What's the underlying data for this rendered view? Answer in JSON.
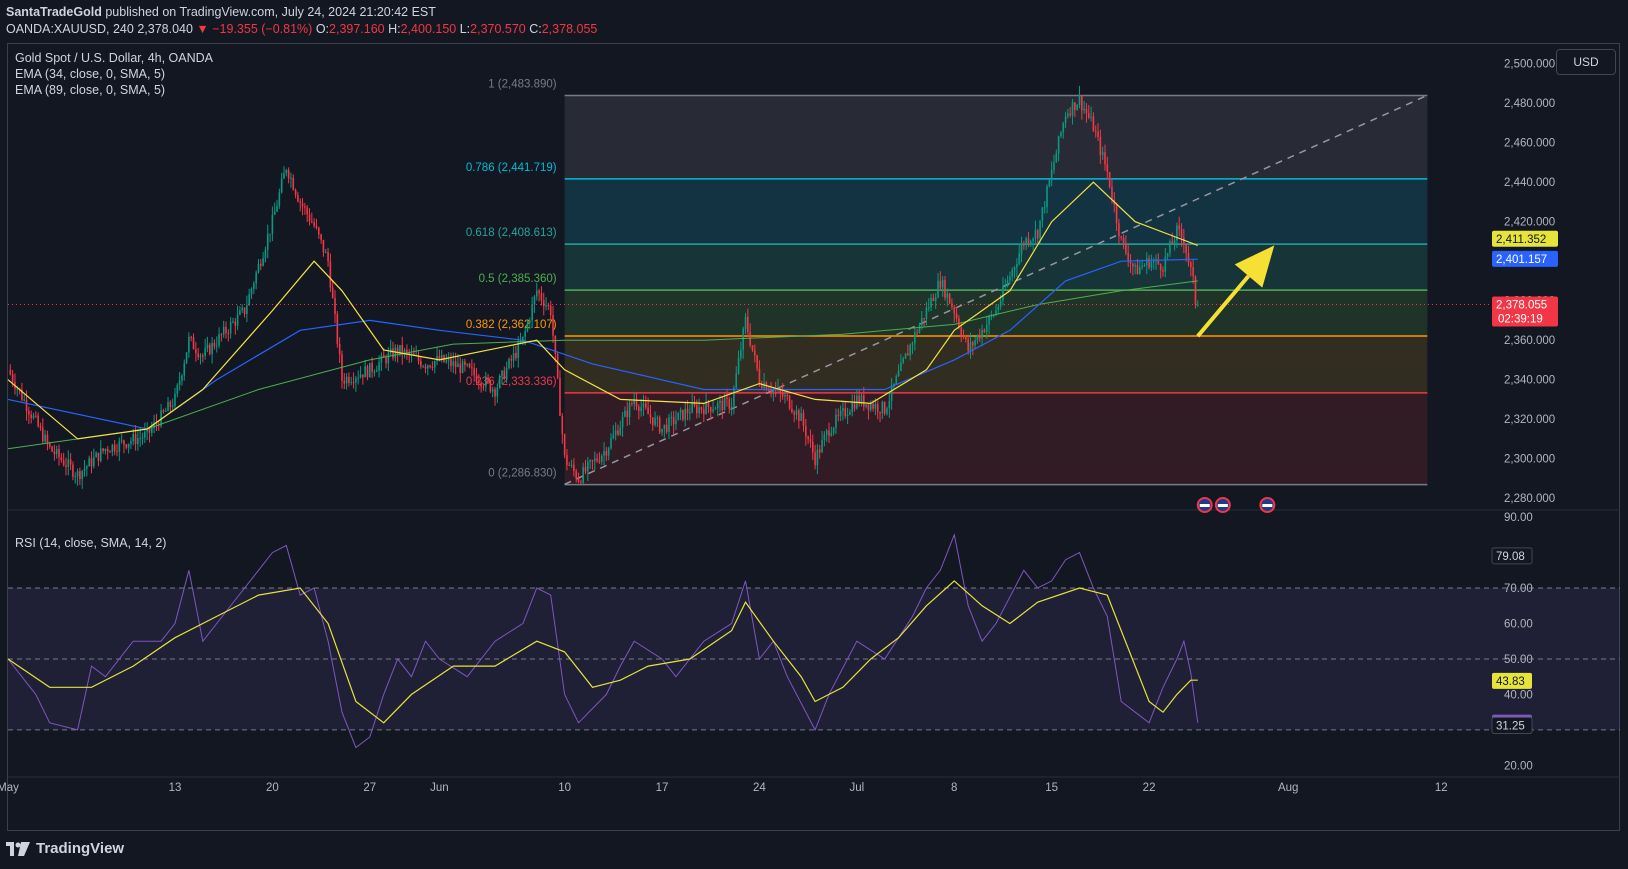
{
  "header": {
    "publisher": "SantaTradeGold",
    "published_text": "published on TradingView.com, July 24, 2024 21:20:42 EST",
    "symbol": "OANDA:XAUUSD, 240",
    "last": "2,378.040",
    "change": "▼ −19.355 (−0.81%)",
    "o_label": "O:",
    "o_value": "2,397.160",
    "h_label": "H:",
    "h_value": "2,400.150",
    "l_label": "L:",
    "l_value": "2,370.570",
    "c_label": "C:",
    "c_value": "2,378.055"
  },
  "legend": {
    "title": "Gold Spot / U.S. Dollar, 4h, OANDA",
    "ema34": "EMA (34, close, 0, SMA, 5)",
    "ema89": "EMA (89, close, 0, SMA, 5)",
    "rsi": "RSI (14, close, SMA, 14, 2)"
  },
  "currency_button": "USD",
  "footer": {
    "brand": "TradingView"
  },
  "colors": {
    "background": "#131722",
    "bull": "#089981",
    "bear": "#f23645",
    "ema34": "#f5e33d",
    "ema89": "#2962ff",
    "ema_long": "#4caf50",
    "rsi": "#7e57c2",
    "rsi_ma": "#e6e33a",
    "arrow": "#f5e033"
  },
  "chart_data": [
    {
      "type": "candlestick",
      "title": "Gold Spot / U.S. Dollar, 4h, OANDA",
      "ylim": [
        2275,
        2510
      ],
      "y_ticks": [
        "2,280.000",
        "2,300.000",
        "2,320.000",
        "2,340.000",
        "2,360.000",
        "2,380.000",
        "2,400.000",
        "2,420.000",
        "2,440.000",
        "2,460.000",
        "2,480.000",
        "2,500.000"
      ],
      "x_ticks": [
        "May",
        "13",
        "20",
        "27",
        "Jun",
        "10",
        "17",
        "24",
        "Jul",
        "8",
        "15",
        "22",
        "Aug",
        "12"
      ],
      "x_tick_days": [
        0,
        12,
        19,
        26,
        31,
        40,
        47,
        54,
        61,
        68,
        75,
        82,
        92,
        103
      ],
      "price_path": [
        [
          0,
          2345
        ],
        [
          3,
          2305
        ],
        [
          5,
          2292
        ],
        [
          7,
          2305
        ],
        [
          10,
          2312
        ],
        [
          12,
          2330
        ],
        [
          13,
          2360
        ],
        [
          14,
          2352
        ],
        [
          17,
          2375
        ],
        [
          19,
          2420
        ],
        [
          20,
          2448
        ],
        [
          21,
          2430
        ],
        [
          22,
          2418
        ],
        [
          23,
          2400
        ],
        [
          24,
          2340
        ],
        [
          26,
          2345
        ],
        [
          28,
          2355
        ],
        [
          30,
          2348
        ],
        [
          31,
          2350
        ],
        [
          33,
          2345
        ],
        [
          35,
          2335
        ],
        [
          37,
          2360
        ],
        [
          38,
          2385
        ],
        [
          39,
          2375
        ],
        [
          40,
          2300
        ],
        [
          41,
          2290
        ],
        [
          43,
          2305
        ],
        [
          45,
          2330
        ],
        [
          47,
          2315
        ],
        [
          49,
          2325
        ],
        [
          52,
          2328
        ],
        [
          53,
          2370
        ],
        [
          54,
          2340
        ],
        [
          56,
          2330
        ],
        [
          57,
          2320
        ],
        [
          58,
          2300
        ],
        [
          59,
          2315
        ],
        [
          61,
          2330
        ],
        [
          63,
          2325
        ],
        [
          65,
          2360
        ],
        [
          67,
          2390
        ],
        [
          68,
          2375
        ],
        [
          69,
          2355
        ],
        [
          71,
          2375
        ],
        [
          73,
          2410
        ],
        [
          74,
          2415
        ],
        [
          75,
          2445
        ],
        [
          76,
          2475
        ],
        [
          77,
          2482
        ],
        [
          78,
          2468
        ],
        [
          79,
          2445
        ],
        [
          80,
          2410
        ],
        [
          81,
          2395
        ],
        [
          82,
          2400
        ],
        [
          83,
          2398
        ],
        [
          84,
          2415
        ],
        [
          84.5,
          2411
        ],
        [
          85,
          2395
        ],
        [
          85.5,
          2378
        ]
      ],
      "ema34_path": [
        [
          0,
          2340
        ],
        [
          5,
          2310
        ],
        [
          10,
          2315
        ],
        [
          14,
          2335
        ],
        [
          19,
          2375
        ],
        [
          22,
          2400
        ],
        [
          24,
          2385
        ],
        [
          27,
          2355
        ],
        [
          31,
          2350
        ],
        [
          38,
          2360
        ],
        [
          40,
          2345
        ],
        [
          44,
          2330
        ],
        [
          50,
          2328
        ],
        [
          54,
          2338
        ],
        [
          58,
          2330
        ],
        [
          62,
          2328
        ],
        [
          66,
          2345
        ],
        [
          68,
          2365
        ],
        [
          72,
          2385
        ],
        [
          75,
          2420
        ],
        [
          78,
          2440
        ],
        [
          81,
          2420
        ],
        [
          84,
          2412
        ],
        [
          85.5,
          2408
        ]
      ],
      "ema89_path": [
        [
          0,
          2330
        ],
        [
          10,
          2315
        ],
        [
          15,
          2340
        ],
        [
          21,
          2365
        ],
        [
          26,
          2370
        ],
        [
          31,
          2365
        ],
        [
          37,
          2360
        ],
        [
          42,
          2348
        ],
        [
          50,
          2335
        ],
        [
          57,
          2335
        ],
        [
          63,
          2335
        ],
        [
          68,
          2350
        ],
        [
          72,
          2365
        ],
        [
          76,
          2390
        ],
        [
          80,
          2400
        ],
        [
          85.5,
          2401
        ]
      ],
      "ema_long_path": [
        [
          0,
          2305
        ],
        [
          10,
          2315
        ],
        [
          18,
          2335
        ],
        [
          26,
          2350
        ],
        [
          32,
          2358
        ],
        [
          40,
          2360
        ],
        [
          50,
          2360
        ],
        [
          60,
          2363
        ],
        [
          68,
          2368
        ],
        [
          74,
          2378
        ],
        [
          80,
          2385
        ],
        [
          85.5,
          2390
        ]
      ],
      "fibonacci": {
        "start_day": 40,
        "end_day": 102,
        "levels": [
          {
            "label": "1 (2,483.890)",
            "value": 2483.89,
            "color": "#787b86"
          },
          {
            "label": "0.786 (2,441.719)",
            "value": 2441.719,
            "color": "#00bcd4"
          },
          {
            "label": "0.618 (2,408.613)",
            "value": 2408.613,
            "color": "#26a69a"
          },
          {
            "label": "0.5 (2,385.360)",
            "value": 2385.36,
            "color": "#4caf50"
          },
          {
            "label": "0.382 (2,362.107)",
            "value": 2362.107,
            "color": "#ff9800"
          },
          {
            "label": "0.236 (2,333.336)",
            "value": 2333.336,
            "color": "#f23645"
          },
          {
            "label": "0 (2,286.830)",
            "value": 2286.83,
            "color": "#787b86"
          }
        ]
      },
      "trendline": [
        [
          40,
          2287
        ],
        [
          102,
          2484
        ]
      ],
      "arrow": [
        [
          85.5,
          2362
        ],
        [
          91,
          2408
        ]
      ],
      "price_labels": [
        {
          "text": "2,411.352",
          "value": 2411.352,
          "bg": "#e6e33a",
          "fg": "#131722"
        },
        {
          "text": "2,401.157",
          "value": 2401.157,
          "bg": "#2962ff",
          "fg": "#ffffff"
        },
        {
          "text": "2,378.055",
          "sub": "02:39:19",
          "value": 2378.055,
          "bg": "#f23645",
          "fg": "#ffffff"
        }
      ],
      "event_flags_days": [
        86,
        87.3,
        90.5
      ]
    },
    {
      "type": "line",
      "title": "RSI (14, close, SMA, 14, 2)",
      "ylim": [
        17,
        92
      ],
      "y_ticks": [
        "20.00",
        "30.00",
        "40.00",
        "50.00",
        "60.00",
        "70.00",
        "80.00",
        "90.00"
      ],
      "bands": [
        30,
        50,
        70
      ],
      "rsi_path": [
        [
          0,
          50
        ],
        [
          2,
          40
        ],
        [
          3,
          32
        ],
        [
          5,
          30
        ],
        [
          6,
          48
        ],
        [
          7,
          45
        ],
        [
          9,
          55
        ],
        [
          11,
          55
        ],
        [
          12,
          60
        ],
        [
          13,
          75
        ],
        [
          14,
          55
        ],
        [
          15,
          60
        ],
        [
          17,
          70
        ],
        [
          19,
          80
        ],
        [
          20,
          82
        ],
        [
          21,
          68
        ],
        [
          22,
          70
        ],
        [
          23,
          55
        ],
        [
          24,
          35
        ],
        [
          25,
          25
        ],
        [
          26,
          28
        ],
        [
          27,
          40
        ],
        [
          28,
          50
        ],
        [
          29,
          45
        ],
        [
          30,
          55
        ],
        [
          31,
          50
        ],
        [
          33,
          45
        ],
        [
          35,
          55
        ],
        [
          37,
          60
        ],
        [
          38,
          70
        ],
        [
          39,
          68
        ],
        [
          40,
          40
        ],
        [
          41,
          32
        ],
        [
          43,
          40
        ],
        [
          44,
          48
        ],
        [
          45,
          55
        ],
        [
          47,
          50
        ],
        [
          48,
          45
        ],
        [
          50,
          55
        ],
        [
          52,
          60
        ],
        [
          53,
          72
        ],
        [
          54,
          50
        ],
        [
          55,
          55
        ],
        [
          56,
          45
        ],
        [
          58,
          30
        ],
        [
          59,
          40
        ],
        [
          61,
          55
        ],
        [
          63,
          50
        ],
        [
          65,
          62
        ],
        [
          66,
          70
        ],
        [
          67,
          75
        ],
        [
          68,
          85
        ],
        [
          69,
          65
        ],
        [
          70,
          55
        ],
        [
          71,
          60
        ],
        [
          73,
          75
        ],
        [
          74,
          70
        ],
        [
          75,
          72
        ],
        [
          76,
          78
        ],
        [
          77,
          80
        ],
        [
          78,
          70
        ],
        [
          79,
          62
        ],
        [
          80,
          38
        ],
        [
          81,
          35
        ],
        [
          82,
          32
        ],
        [
          83,
          42
        ],
        [
          84,
          50
        ],
        [
          84.5,
          55
        ],
        [
          85,
          46
        ],
        [
          85.5,
          32
        ]
      ],
      "rsi_ma_path": [
        [
          0,
          50
        ],
        [
          3,
          42
        ],
        [
          6,
          42
        ],
        [
          9,
          48
        ],
        [
          12,
          56
        ],
        [
          15,
          62
        ],
        [
          18,
          68
        ],
        [
          21,
          70
        ],
        [
          23,
          60
        ],
        [
          25,
          38
        ],
        [
          27,
          32
        ],
        [
          29,
          40
        ],
        [
          32,
          48
        ],
        [
          35,
          48
        ],
        [
          38,
          55
        ],
        [
          40,
          52
        ],
        [
          42,
          42
        ],
        [
          44,
          44
        ],
        [
          46,
          48
        ],
        [
          49,
          50
        ],
        [
          52,
          58
        ],
        [
          53,
          66
        ],
        [
          55,
          55
        ],
        [
          57,
          45
        ],
        [
          58,
          38
        ],
        [
          60,
          42
        ],
        [
          62,
          50
        ],
        [
          64,
          56
        ],
        [
          66,
          65
        ],
        [
          68,
          72
        ],
        [
          70,
          65
        ],
        [
          72,
          60
        ],
        [
          74,
          66
        ],
        [
          77,
          70
        ],
        [
          79,
          68
        ],
        [
          80,
          58
        ],
        [
          82,
          38
        ],
        [
          83,
          35
        ],
        [
          84,
          40
        ],
        [
          85,
          44
        ],
        [
          85.5,
          44
        ]
      ],
      "value_labels": [
        {
          "text": "79.08",
          "value": 79.08,
          "bg": "#131722",
          "fg": "#d1d4dc",
          "border": "#434651"
        },
        {
          "text": "43.83",
          "value": 43.83,
          "bg": "#e6e33a",
          "fg": "#131722"
        },
        {
          "text": "32.04",
          "value": 32.04,
          "bg": "#7e57c2",
          "fg": "#ffffff"
        },
        {
          "text": "31.25",
          "value": 31.25,
          "bg": "#131722",
          "fg": "#d1d4dc",
          "border": "#434651"
        }
      ]
    }
  ]
}
